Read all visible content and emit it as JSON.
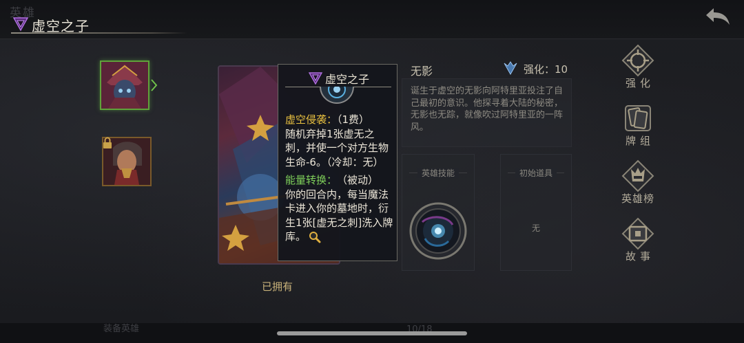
{
  "header": {
    "ghost_title": "英雄",
    "title": "虚空之子"
  },
  "card": {
    "owned_label": "已拥有"
  },
  "tooltip": {
    "title": "虚空之子",
    "skill1_name": "虚空侵袭：",
    "skill1_tag": "（1费）",
    "skill1_desc": "随机弃掉1张虚无之刺，并使一个对方生物生命-6。（冷却：无）",
    "skill2_name": "能量转换：",
    "skill2_tag": "（被动）",
    "skill2_desc": "你的回合内，每当魔法卡进入你的墓地时，衍生1张[虚无之刺]洗入牌库。"
  },
  "info": {
    "hero_name": "无影",
    "enhance_label": "强化：10",
    "lore": "诞生于虚空的无影向阿特里亚投注了自己最初的意识。他探寻着大陆的秘密，无影也无踪，就像吹过阿特里亚的一阵风。"
  },
  "panels": {
    "hero_skill_title": "英雄技能",
    "starting_item_title": "初始道具",
    "starting_item_value": "无"
  },
  "side_menu": {
    "enhance": "强化",
    "deck": "牌组",
    "hero_ranking": "英雄榜",
    "story": "故事"
  },
  "footer": {
    "ghost_label": "装备英雄",
    "ghost_page": "10/18"
  },
  "colors": {
    "selected_border": "#5fa33a",
    "skill_yellow": "#e8c040",
    "skill_green": "#7fd05a"
  }
}
